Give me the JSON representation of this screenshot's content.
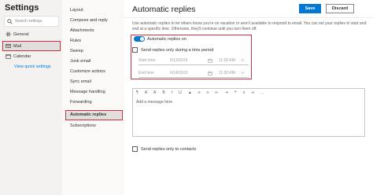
{
  "sidebar": {
    "title": "Settings",
    "search_placeholder": "Search settings",
    "items": [
      {
        "label": "General",
        "icon": "gear-icon"
      },
      {
        "label": "Mail",
        "icon": "envelope-icon"
      },
      {
        "label": "Calendar",
        "icon": "calendar-icon"
      }
    ],
    "quick_link": "View quick settings"
  },
  "mail_menu": {
    "items": [
      "Layout",
      "Compose and reply",
      "Attachments",
      "Rules",
      "Sweep",
      "Junk email",
      "Customize actions",
      "Sync email",
      "Message handling",
      "Forwarding",
      "Automatic replies",
      "Subscriptions"
    ],
    "selected": "Automatic replies"
  },
  "pane": {
    "title": "Automatic replies",
    "save_label": "Save",
    "discard_label": "Discard",
    "description": "Use automatic replies to let others know you're on vacation or aren't available to respond to email. You can set your replies to start and end at a specific time. Otherwise, they'll continue until you turn them off.",
    "toggle_label": "Automatic replies on",
    "toggle_on": true,
    "time_period_label": "Send replies only during a time period",
    "start_label": "Start time",
    "start_date": "6/13/2019",
    "start_time": "11:00 AM",
    "end_label": "End time",
    "end_date": "6/14/2019",
    "end_time": "11:00 AM",
    "editor_placeholder": "Add a message here",
    "contacts_label": "Send replies only to contacts"
  },
  "colors": {
    "accent": "#0078d4",
    "highlight": "#d0333f"
  }
}
